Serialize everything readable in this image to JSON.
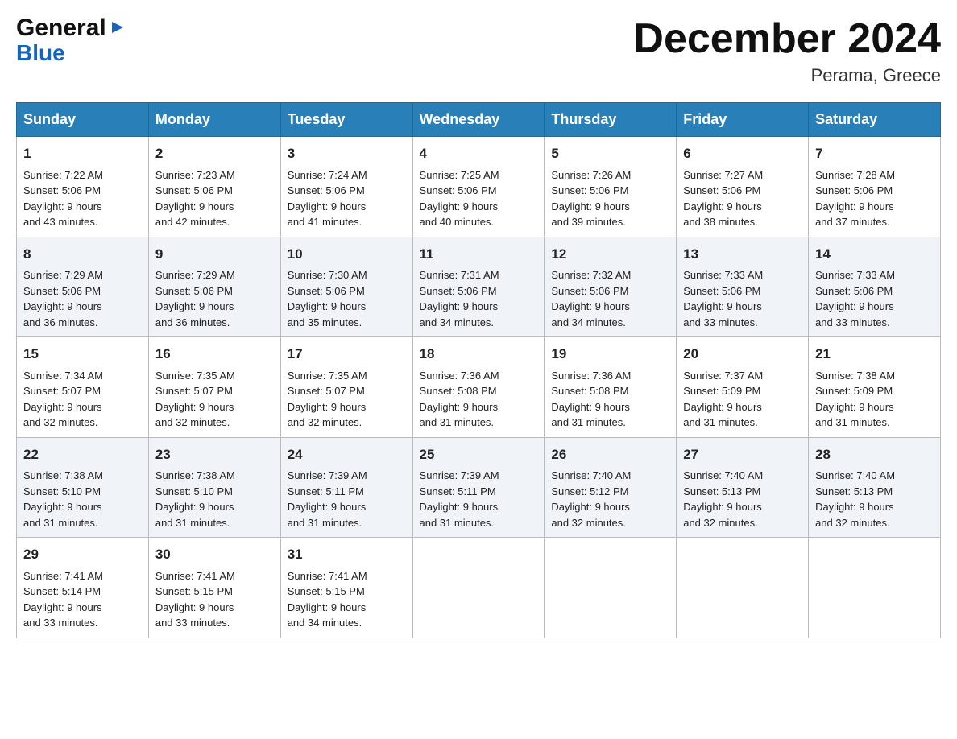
{
  "logo": {
    "line1": "General",
    "arrow": "▶",
    "line2": "Blue"
  },
  "title": "December 2024",
  "location": "Perama, Greece",
  "days_of_week": [
    "Sunday",
    "Monday",
    "Tuesday",
    "Wednesday",
    "Thursday",
    "Friday",
    "Saturday"
  ],
  "weeks": [
    [
      {
        "day": "1",
        "sunrise": "7:22 AM",
        "sunset": "5:06 PM",
        "daylight": "9 hours and 43 minutes."
      },
      {
        "day": "2",
        "sunrise": "7:23 AM",
        "sunset": "5:06 PM",
        "daylight": "9 hours and 42 minutes."
      },
      {
        "day": "3",
        "sunrise": "7:24 AM",
        "sunset": "5:06 PM",
        "daylight": "9 hours and 41 minutes."
      },
      {
        "day": "4",
        "sunrise": "7:25 AM",
        "sunset": "5:06 PM",
        "daylight": "9 hours and 40 minutes."
      },
      {
        "day": "5",
        "sunrise": "7:26 AM",
        "sunset": "5:06 PM",
        "daylight": "9 hours and 39 minutes."
      },
      {
        "day": "6",
        "sunrise": "7:27 AM",
        "sunset": "5:06 PM",
        "daylight": "9 hours and 38 minutes."
      },
      {
        "day": "7",
        "sunrise": "7:28 AM",
        "sunset": "5:06 PM",
        "daylight": "9 hours and 37 minutes."
      }
    ],
    [
      {
        "day": "8",
        "sunrise": "7:29 AM",
        "sunset": "5:06 PM",
        "daylight": "9 hours and 36 minutes."
      },
      {
        "day": "9",
        "sunrise": "7:29 AM",
        "sunset": "5:06 PM",
        "daylight": "9 hours and 36 minutes."
      },
      {
        "day": "10",
        "sunrise": "7:30 AM",
        "sunset": "5:06 PM",
        "daylight": "9 hours and 35 minutes."
      },
      {
        "day": "11",
        "sunrise": "7:31 AM",
        "sunset": "5:06 PM",
        "daylight": "9 hours and 34 minutes."
      },
      {
        "day": "12",
        "sunrise": "7:32 AM",
        "sunset": "5:06 PM",
        "daylight": "9 hours and 34 minutes."
      },
      {
        "day": "13",
        "sunrise": "7:33 AM",
        "sunset": "5:06 PM",
        "daylight": "9 hours and 33 minutes."
      },
      {
        "day": "14",
        "sunrise": "7:33 AM",
        "sunset": "5:06 PM",
        "daylight": "9 hours and 33 minutes."
      }
    ],
    [
      {
        "day": "15",
        "sunrise": "7:34 AM",
        "sunset": "5:07 PM",
        "daylight": "9 hours and 32 minutes."
      },
      {
        "day": "16",
        "sunrise": "7:35 AM",
        "sunset": "5:07 PM",
        "daylight": "9 hours and 32 minutes."
      },
      {
        "day": "17",
        "sunrise": "7:35 AM",
        "sunset": "5:07 PM",
        "daylight": "9 hours and 32 minutes."
      },
      {
        "day": "18",
        "sunrise": "7:36 AM",
        "sunset": "5:08 PM",
        "daylight": "9 hours and 31 minutes."
      },
      {
        "day": "19",
        "sunrise": "7:36 AM",
        "sunset": "5:08 PM",
        "daylight": "9 hours and 31 minutes."
      },
      {
        "day": "20",
        "sunrise": "7:37 AM",
        "sunset": "5:09 PM",
        "daylight": "9 hours and 31 minutes."
      },
      {
        "day": "21",
        "sunrise": "7:38 AM",
        "sunset": "5:09 PM",
        "daylight": "9 hours and 31 minutes."
      }
    ],
    [
      {
        "day": "22",
        "sunrise": "7:38 AM",
        "sunset": "5:10 PM",
        "daylight": "9 hours and 31 minutes."
      },
      {
        "day": "23",
        "sunrise": "7:38 AM",
        "sunset": "5:10 PM",
        "daylight": "9 hours and 31 minutes."
      },
      {
        "day": "24",
        "sunrise": "7:39 AM",
        "sunset": "5:11 PM",
        "daylight": "9 hours and 31 minutes."
      },
      {
        "day": "25",
        "sunrise": "7:39 AM",
        "sunset": "5:11 PM",
        "daylight": "9 hours and 31 minutes."
      },
      {
        "day": "26",
        "sunrise": "7:40 AM",
        "sunset": "5:12 PM",
        "daylight": "9 hours and 32 minutes."
      },
      {
        "day": "27",
        "sunrise": "7:40 AM",
        "sunset": "5:13 PM",
        "daylight": "9 hours and 32 minutes."
      },
      {
        "day": "28",
        "sunrise": "7:40 AM",
        "sunset": "5:13 PM",
        "daylight": "9 hours and 32 minutes."
      }
    ],
    [
      {
        "day": "29",
        "sunrise": "7:41 AM",
        "sunset": "5:14 PM",
        "daylight": "9 hours and 33 minutes."
      },
      {
        "day": "30",
        "sunrise": "7:41 AM",
        "sunset": "5:15 PM",
        "daylight": "9 hours and 33 minutes."
      },
      {
        "day": "31",
        "sunrise": "7:41 AM",
        "sunset": "5:15 PM",
        "daylight": "9 hours and 34 minutes."
      },
      null,
      null,
      null,
      null
    ]
  ],
  "labels": {
    "sunrise": "Sunrise:",
    "sunset": "Sunset:",
    "daylight": "Daylight:"
  }
}
